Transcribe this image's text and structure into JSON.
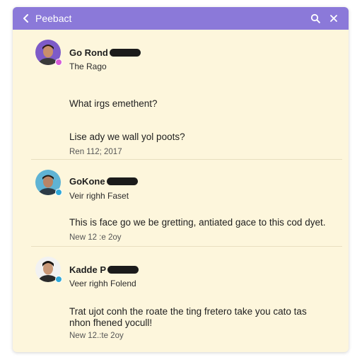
{
  "header": {
    "title": "Peebact",
    "back_icon": "chevron-left-icon",
    "search_icon": "search-icon",
    "close_icon": "close-icon",
    "bg_color": "#8b79d9"
  },
  "posts": [
    {
      "name": "Go Rond",
      "subtitle": "The Rago",
      "lines": [
        "What irgs emethent?",
        "Lise ady we wall yol poots?"
      ],
      "meta": "Ren 112; 2017",
      "badge_color": "#d65ad6"
    },
    {
      "name": "GoKone",
      "subtitle": "Veir righh Faset",
      "lines": [
        "This is face go we be gretting, antiated gace to this cod dyet."
      ],
      "meta": "New 12 :e 2oy",
      "badge_color": "#2fa8d8"
    },
    {
      "name": "Kadde P",
      "subtitle": "Veer righh Folend",
      "lines": [
        "Trat ujot conh the roate the ting fretero take you cato tas",
        "nhon fhened yocull!"
      ],
      "meta": "New 12.:te 2oy",
      "badge_color": "#2fa8d8"
    }
  ]
}
